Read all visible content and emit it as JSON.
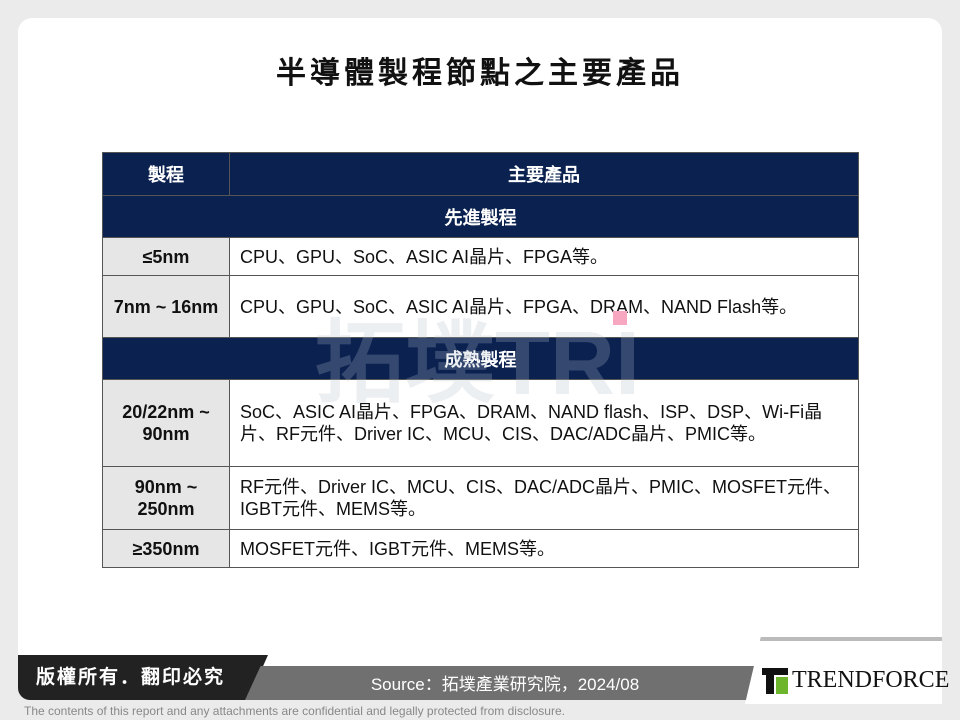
{
  "title": "半導體製程節點之主要產品",
  "table": {
    "headers": [
      "製程",
      "主要產品"
    ],
    "sections": [
      {
        "label": "先進製程",
        "rows": [
          {
            "process": "≤5nm",
            "products": "CPU、GPU、SoC、ASIC AI晶片、FPGA等。"
          },
          {
            "process": "7nm ~ 16nm",
            "products": "CPU、GPU、SoC、ASIC AI晶片、FPGA、DRAM、NAND Flash等。"
          }
        ]
      },
      {
        "label": "成熟製程",
        "rows": [
          {
            "process": "20/22nm ~ 90nm",
            "products": "SoC、ASIC AI晶片、FPGA、DRAM、NAND flash、ISP、DSP、Wi-Fi晶片、RF元件、Driver IC、MCU、CIS、DAC/ADC晶片、PMIC等。"
          },
          {
            "process": "90nm ~ 250nm",
            "products": "RF元件、Driver IC、MCU、CIS、DAC/ADC晶片、PMIC、MOSFET元件、IGBT元件、MEMS等。"
          },
          {
            "process": "≥350nm",
            "products": "MOSFET元件、IGBT元件、MEMS等。"
          }
        ]
      }
    ]
  },
  "watermark": "拓墣TRI",
  "footer": {
    "copyright": "版權所有．翻印必究",
    "source": "Source：拓墣產業研究院，2024/08",
    "logo": "TRENDFORCE",
    "disclaimer": "The contents of this report and any attachments are confidential and legally protected from disclosure."
  },
  "colors": {
    "header_bg": "#0b2150",
    "process_bg": "#e6e6e6",
    "logo_green": "#6cb52d"
  }
}
